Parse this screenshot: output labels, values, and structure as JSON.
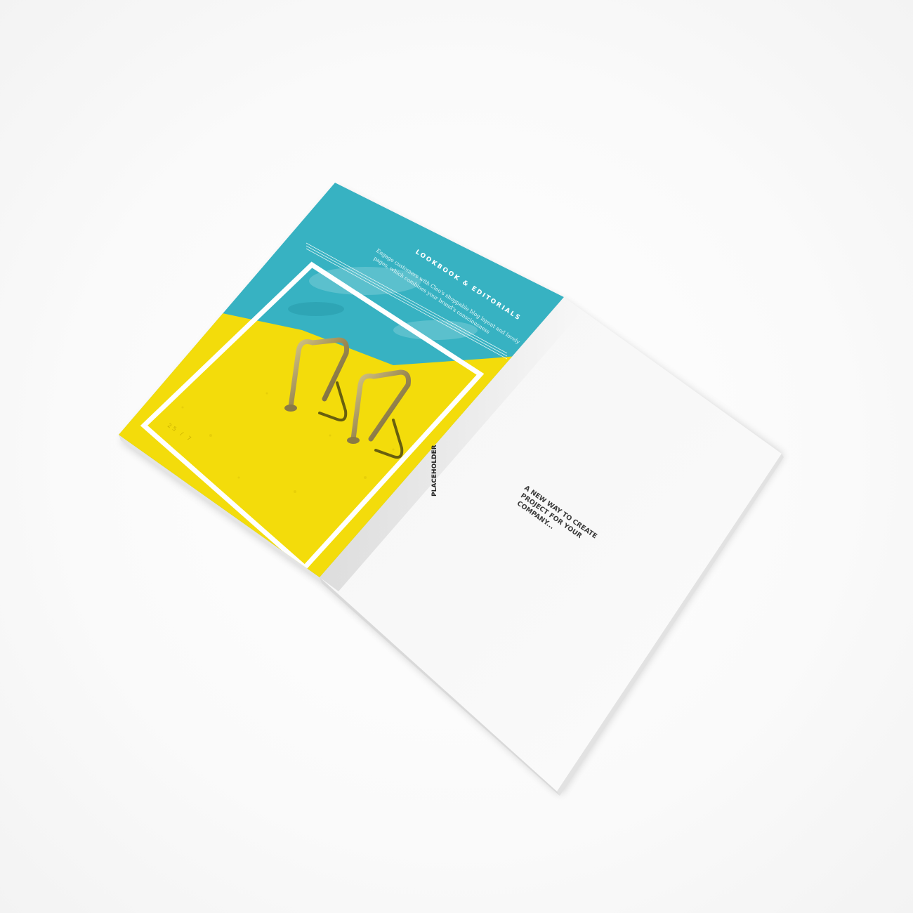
{
  "left_page": {
    "heading": "LOOKBOOK & EDITORIALS",
    "body_line_1": "Engage customers with Cleo's shoppable blog layout and lovely",
    "body_line_2": "pages, which combines your brand's consciousness",
    "corner_mark": "25 / 7",
    "spine_label": "PLACEHOLDER"
  },
  "right_page": {
    "tagline_line_1": "A NEW WAY TO CREATE",
    "tagline_line_2": "PROJECT FOR YOUR",
    "tagline_line_3": "COMPANY..."
  },
  "colors": {
    "pool_blue": "#37b2c2",
    "pool_yellow": "#f3dc0b",
    "paper": "#f7f7f7",
    "background": "#ffffff"
  }
}
